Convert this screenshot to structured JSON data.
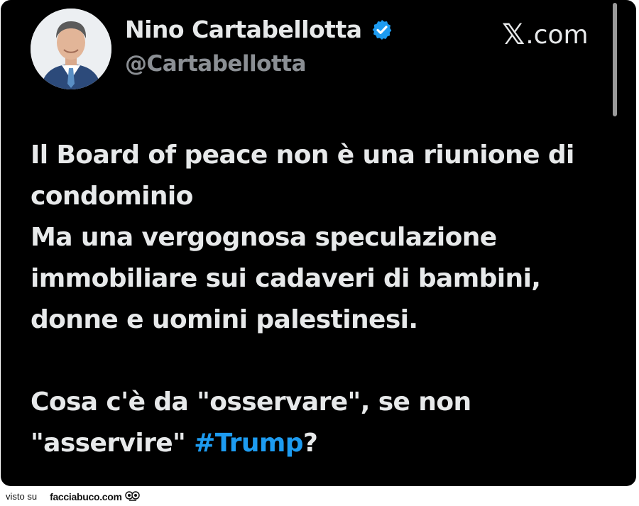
{
  "profile": {
    "display_name": "Nino Cartabellotta",
    "handle": "@Cartabellotta",
    "verified_color": "#1d9bf0"
  },
  "brand": {
    "x_glyph": "𝕏",
    "domain": ".com"
  },
  "tweet": {
    "line1": "Il Board of peace non è una riunione di",
    "line2": "condominio",
    "line3": "Ma una vergognosa speculazione",
    "line4": "immobiliare sui cadaveri di bambini,",
    "line5": "donne e uomini palestinesi.",
    "line6": "Cosa c'è da \"osservare\", se non",
    "line7_prefix": "\"asservire\" ",
    "hashtag": "#Trump",
    "line7_suffix": "?",
    "hashtag_color": "#1d9bf0"
  },
  "footer": {
    "visto_su": "visto su",
    "site": "facciabuco.com"
  }
}
